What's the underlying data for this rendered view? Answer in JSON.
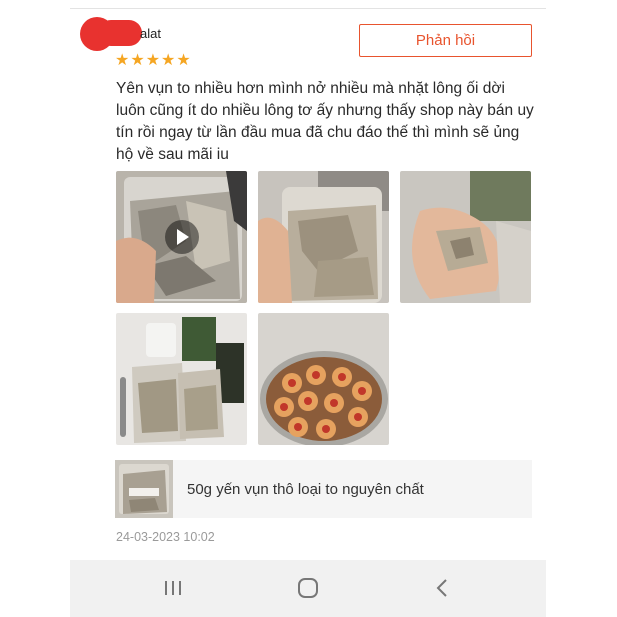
{
  "review": {
    "username": "alat",
    "rating": 5,
    "stars": [
      "★",
      "★",
      "★",
      "★",
      "★"
    ],
    "reply_label": "Phản hồi",
    "text": "Yên vụn to nhiều hơn mình nở nhiều mà nhặt lông ối dời luôn cũng ít do nhiều lông tơ ấy  nhưng thấy shop này bán uy tín rồi ngay từ lần đầu mua đã chu đáo thế thì mình sẽ ủng hộ về sau mãi iu",
    "timestamp": "24-03-2023 10:02"
  },
  "media": [
    {
      "kind": "video",
      "icon": "play-icon"
    },
    {
      "kind": "photo"
    },
    {
      "kind": "photo"
    },
    {
      "kind": "photo"
    },
    {
      "kind": "photo"
    }
  ],
  "product": {
    "name": "50g yến vụn thô loại to nguyên chất"
  },
  "navbar": {
    "icons": [
      "recent-apps-icon",
      "home-icon",
      "back-icon"
    ]
  },
  "colors": {
    "accent": "#e8542e",
    "star": "#f5a623",
    "redaction": "#e8322f",
    "timestamp": "#9a9a9a",
    "navbar_bg": "#f1f1f1",
    "card_bg": "#f5f5f5"
  }
}
